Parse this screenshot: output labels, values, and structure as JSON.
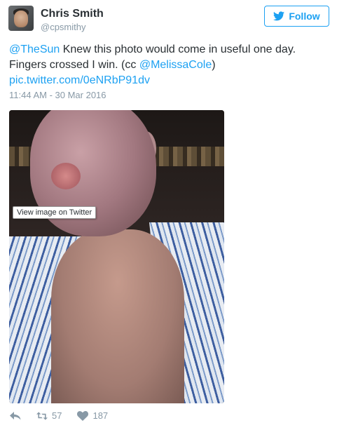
{
  "user": {
    "name": "Chris Smith",
    "handle": "@cpsmithy"
  },
  "follow_label": "Follow",
  "tweet": {
    "mention1": "@TheSun",
    "text1": " Knew this photo would come in useful one day. Fingers crossed I win. (cc ",
    "mention2": "@MelissaCole",
    "text2": ")",
    "link": "pic.twitter.com/0eNRbP91dv"
  },
  "timestamp": "11:44 AM - 30 Mar 2016",
  "photo_tooltip": "View image on Twitter",
  "actions": {
    "retweets": "57",
    "likes": "187"
  },
  "colors": {
    "accent": "#1da1f2",
    "muted": "#8899a6",
    "text": "#292f33"
  },
  "icons": [
    "twitter-bird-icon",
    "reply-icon",
    "retweet-icon",
    "heart-icon"
  ]
}
